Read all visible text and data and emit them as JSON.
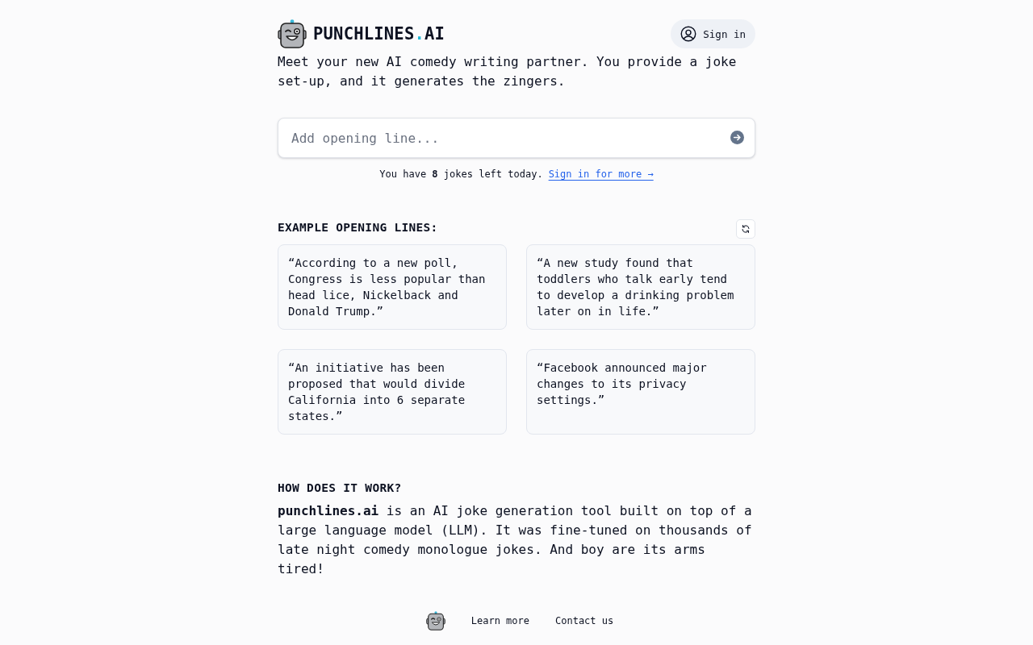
{
  "header": {
    "brand": {
      "parts": [
        {
          "text": "PUNCHLINES",
          "accent": false
        },
        {
          "text": ".",
          "accent": true
        },
        {
          "text": "AI",
          "accent": false
        }
      ]
    },
    "sign_in_button": "Sign in"
  },
  "tagline": "Meet your new AI comedy writing partner. You provide a joke set-up, and it generates the zingers.",
  "prompt": {
    "placeholder": "Add opening line..."
  },
  "quota": {
    "text": "You have **8** jokes left today.",
    "link": "Sign in for more →"
  },
  "examples": {
    "heading": "EXAMPLE OPENING LINES:",
    "cards": [
      "“According to a new poll, Congress is less popular than head lice, Nickelback and Donald Trump.”",
      "“A new study found that toddlers who talk early tend to develop a drinking problem later on in life.”",
      "“An initiative has been proposed that would divide California into 6 separate states.”",
      "“Facebook announced major changes to its privacy settings.”"
    ]
  },
  "about": {
    "heading": "HOW DOES IT WORK?",
    "text": "**punchlines.ai** is an AI joke generation tool built on top of a large language model (LLM). It was fine-tuned on thousands of late night comedy monologue jokes. And boy are its arms tired!"
  },
  "footer": {
    "links": [
      "Learn more",
      "Contact us"
    ]
  }
}
